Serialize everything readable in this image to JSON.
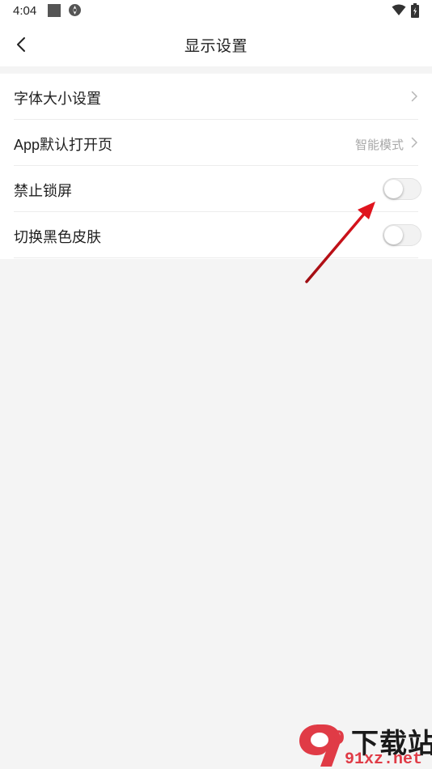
{
  "status_bar": {
    "time": "4:04"
  },
  "header": {
    "title": "显示设置"
  },
  "settings": {
    "items": [
      {
        "label": "字体大小设置",
        "value": "",
        "control": "chevron"
      },
      {
        "label": "App默认打开页",
        "value": "智能模式",
        "control": "chevron"
      },
      {
        "label": "禁止锁屏",
        "control": "toggle",
        "on": false
      },
      {
        "label": "切换黑色皮肤",
        "control": "toggle",
        "on": false
      }
    ]
  },
  "watermark": {
    "logo_text": "9",
    "name": "下载站",
    "url": "91xz.net"
  },
  "colors": {
    "arrow": "#e0141e",
    "watermark_red": "#e03b46",
    "background": "#f4f4f4"
  }
}
